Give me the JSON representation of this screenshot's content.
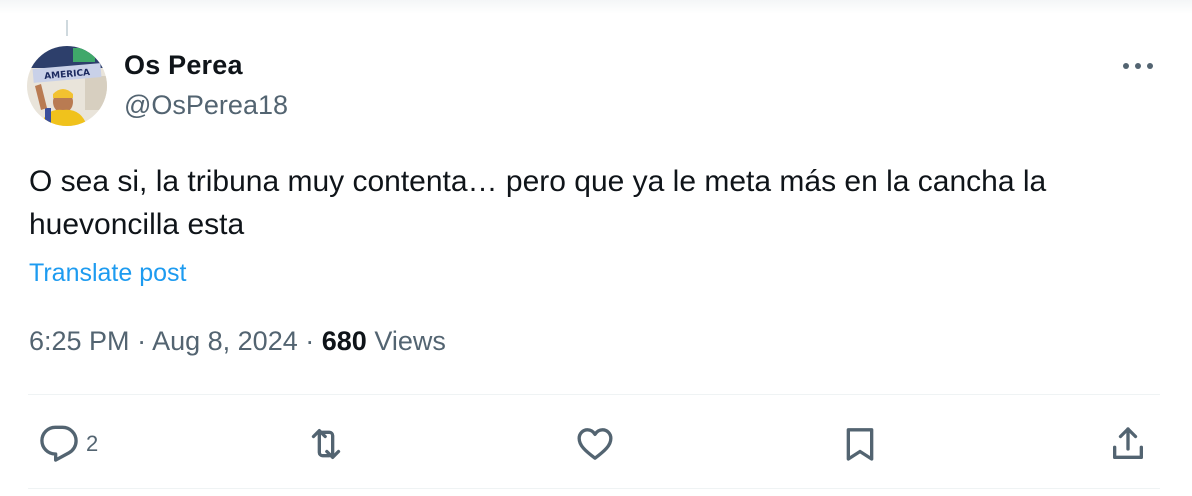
{
  "author": {
    "display_name": "Os Perea",
    "handle": "@OsPerea18",
    "avatar_banner_text": "AMERICA"
  },
  "post": {
    "text": "O sea si, la tribuna muy contenta… pero que ya le meta más en la cancha la huevoncilla esta",
    "translate_label": "Translate post",
    "time": "6:25 PM",
    "separator": "·",
    "date": "Aug 8, 2024",
    "views_count": "680",
    "views_label": "Views"
  },
  "actions": {
    "reply_icon": "reply-icon",
    "reply_count": "2",
    "repost_icon": "repost-icon",
    "like_icon": "heart-icon",
    "bookmark_icon": "bookmark-icon",
    "share_icon": "share-icon"
  },
  "colors": {
    "text_primary": "#0f1419",
    "text_secondary": "#536471",
    "link": "#1d9bf0",
    "divider": "#eff3f4"
  }
}
